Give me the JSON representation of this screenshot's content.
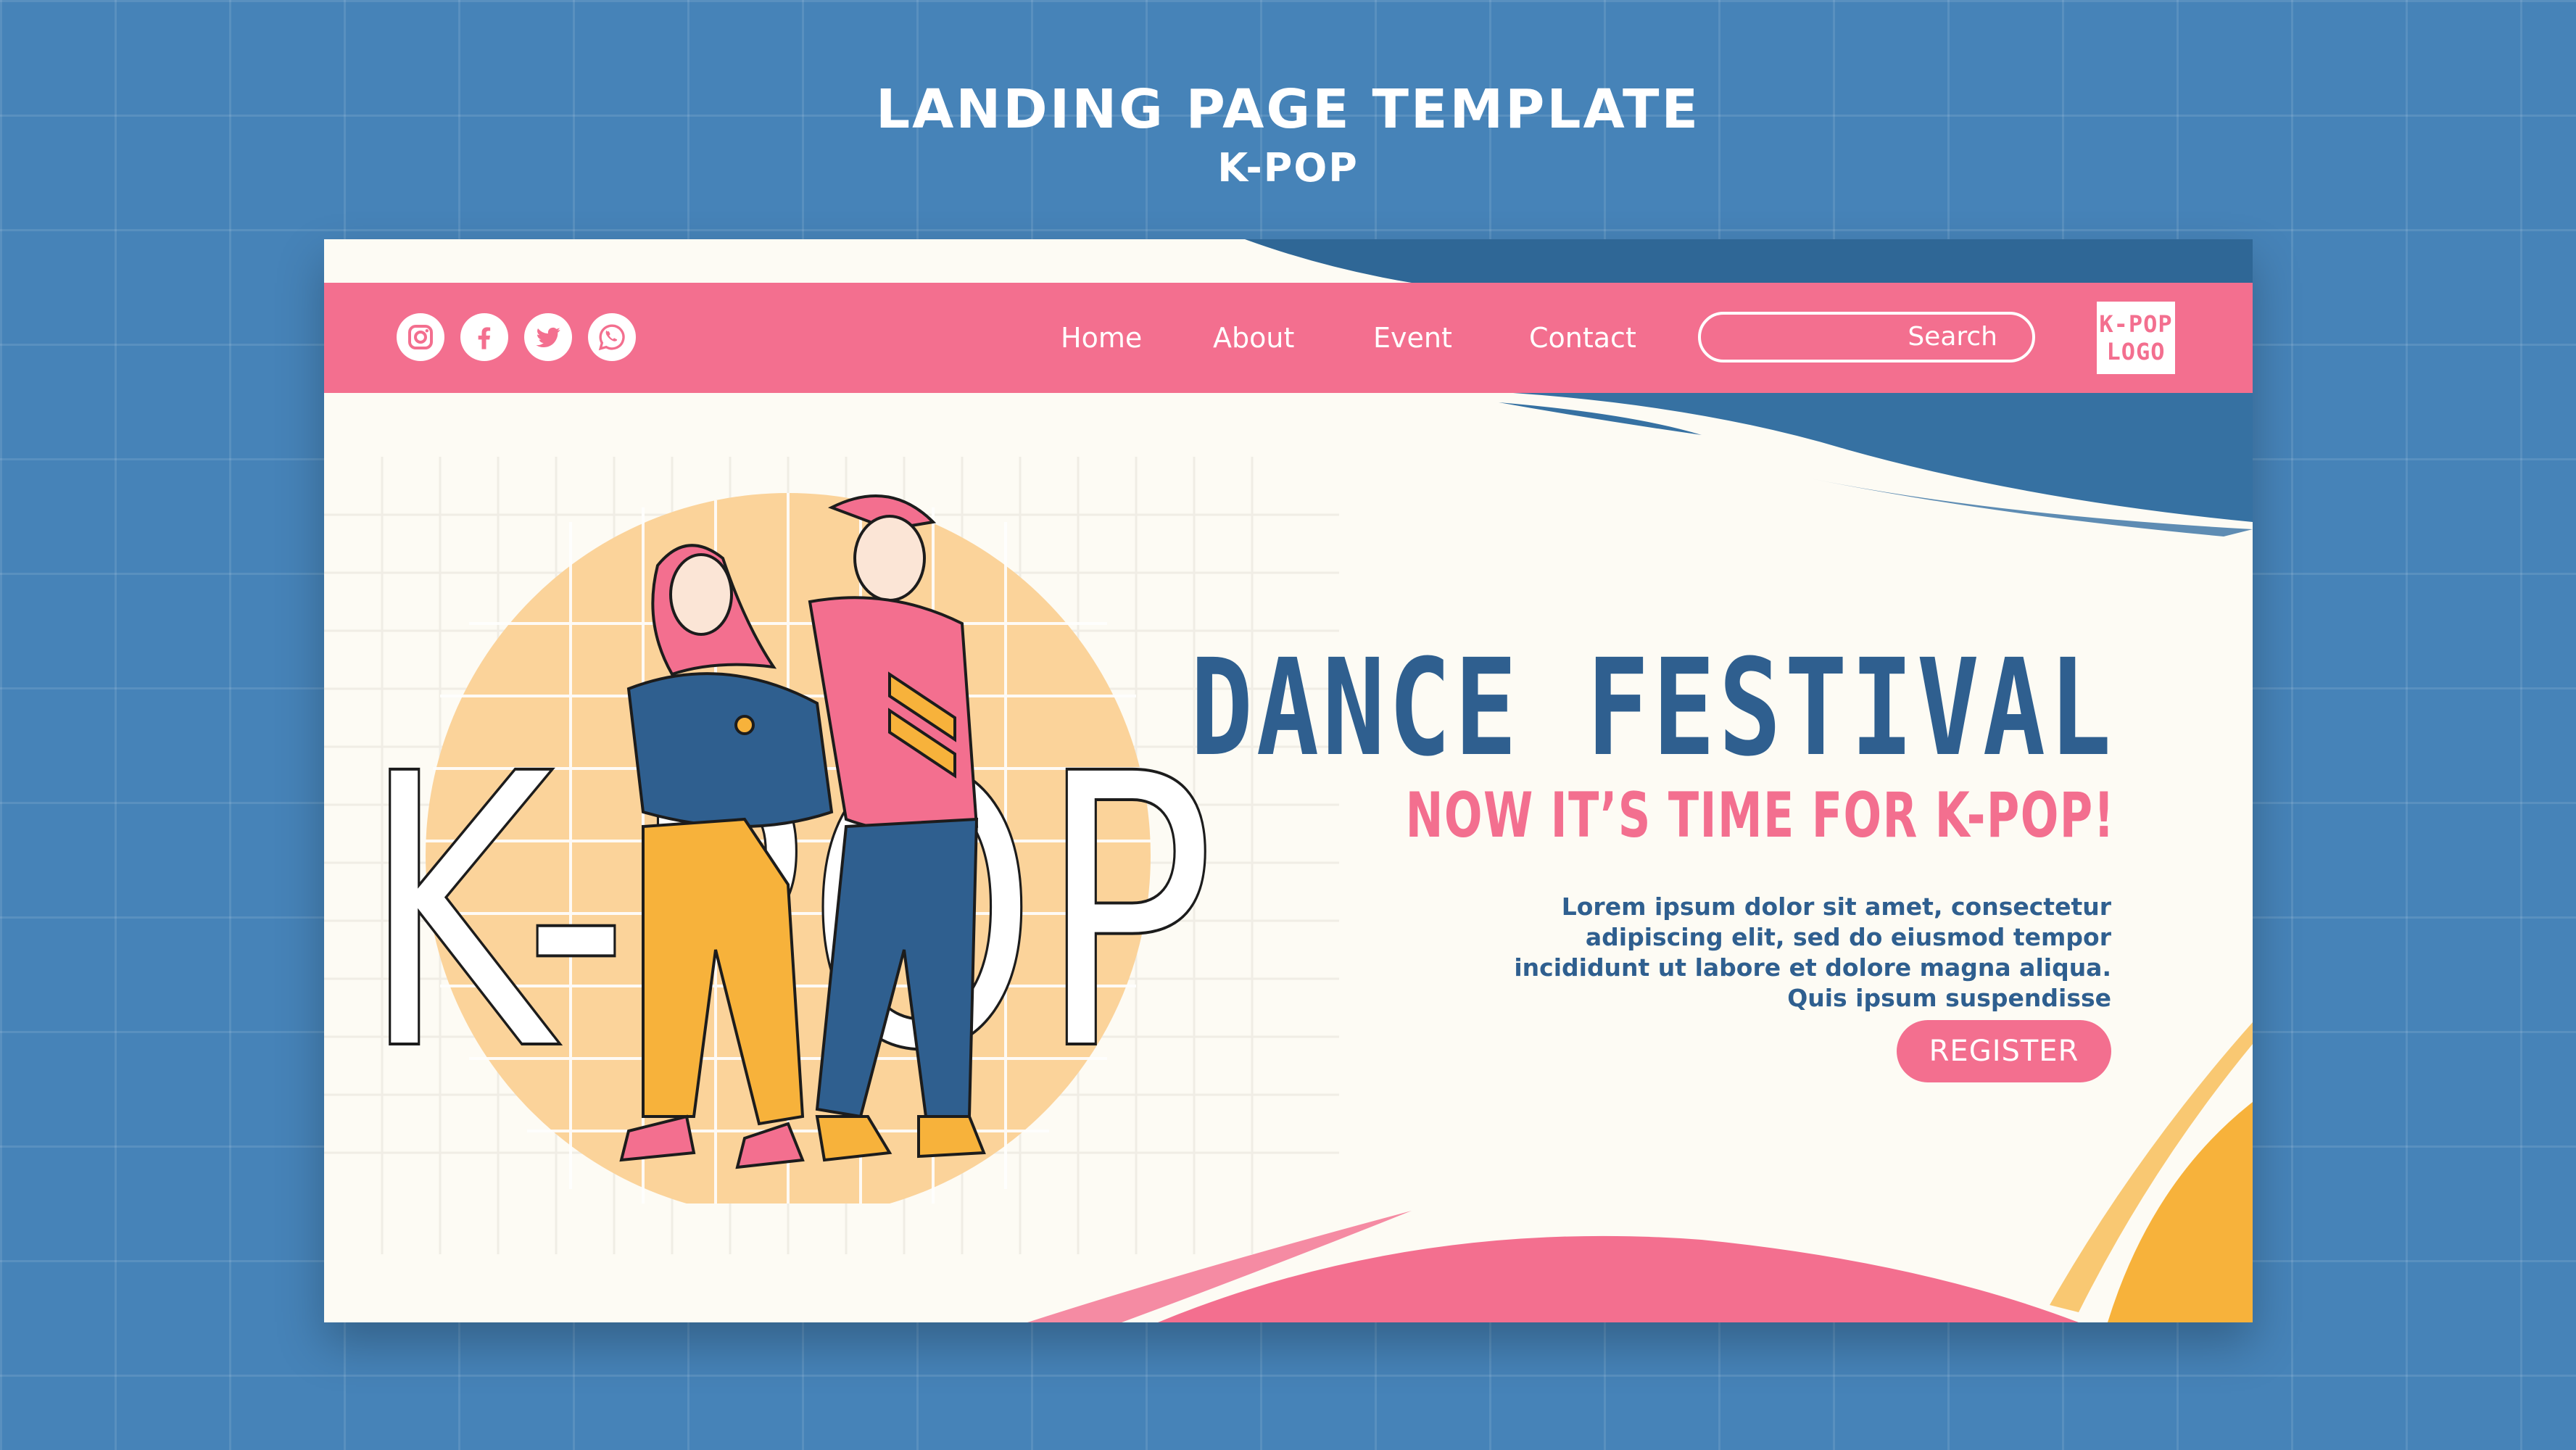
{
  "page": {
    "title": "LANDING PAGE TEMPLATE",
    "subtitle": "K-POP"
  },
  "nav": {
    "social_icons": [
      "instagram-icon",
      "facebook-icon",
      "twitter-icon",
      "whatsapp-icon"
    ],
    "links": [
      "Home",
      "About",
      "Event",
      "Contact"
    ],
    "search_label": "Search",
    "logo_line1": "K-POP",
    "logo_line2": "LOGO"
  },
  "hero": {
    "title": "DANCE FESTIVAL",
    "subtitle": "NOW IT’S TIME FOR K-POP!",
    "body": "Lorem ipsum dolor sit amet, consectetur adipiscing elit, sed do eiusmod tempor incididunt ut labore et dolore magna aliqua. Quis ipsum suspendisse",
    "cta": "REGISTER",
    "illustration_text": "K-POP"
  },
  "colors": {
    "background": "#4683b8",
    "card": "#fdfbf4",
    "pink": "#f36f8f",
    "navy": "#2f5f8f",
    "orange": "#f7b23b",
    "peach": "#fbd39a"
  }
}
